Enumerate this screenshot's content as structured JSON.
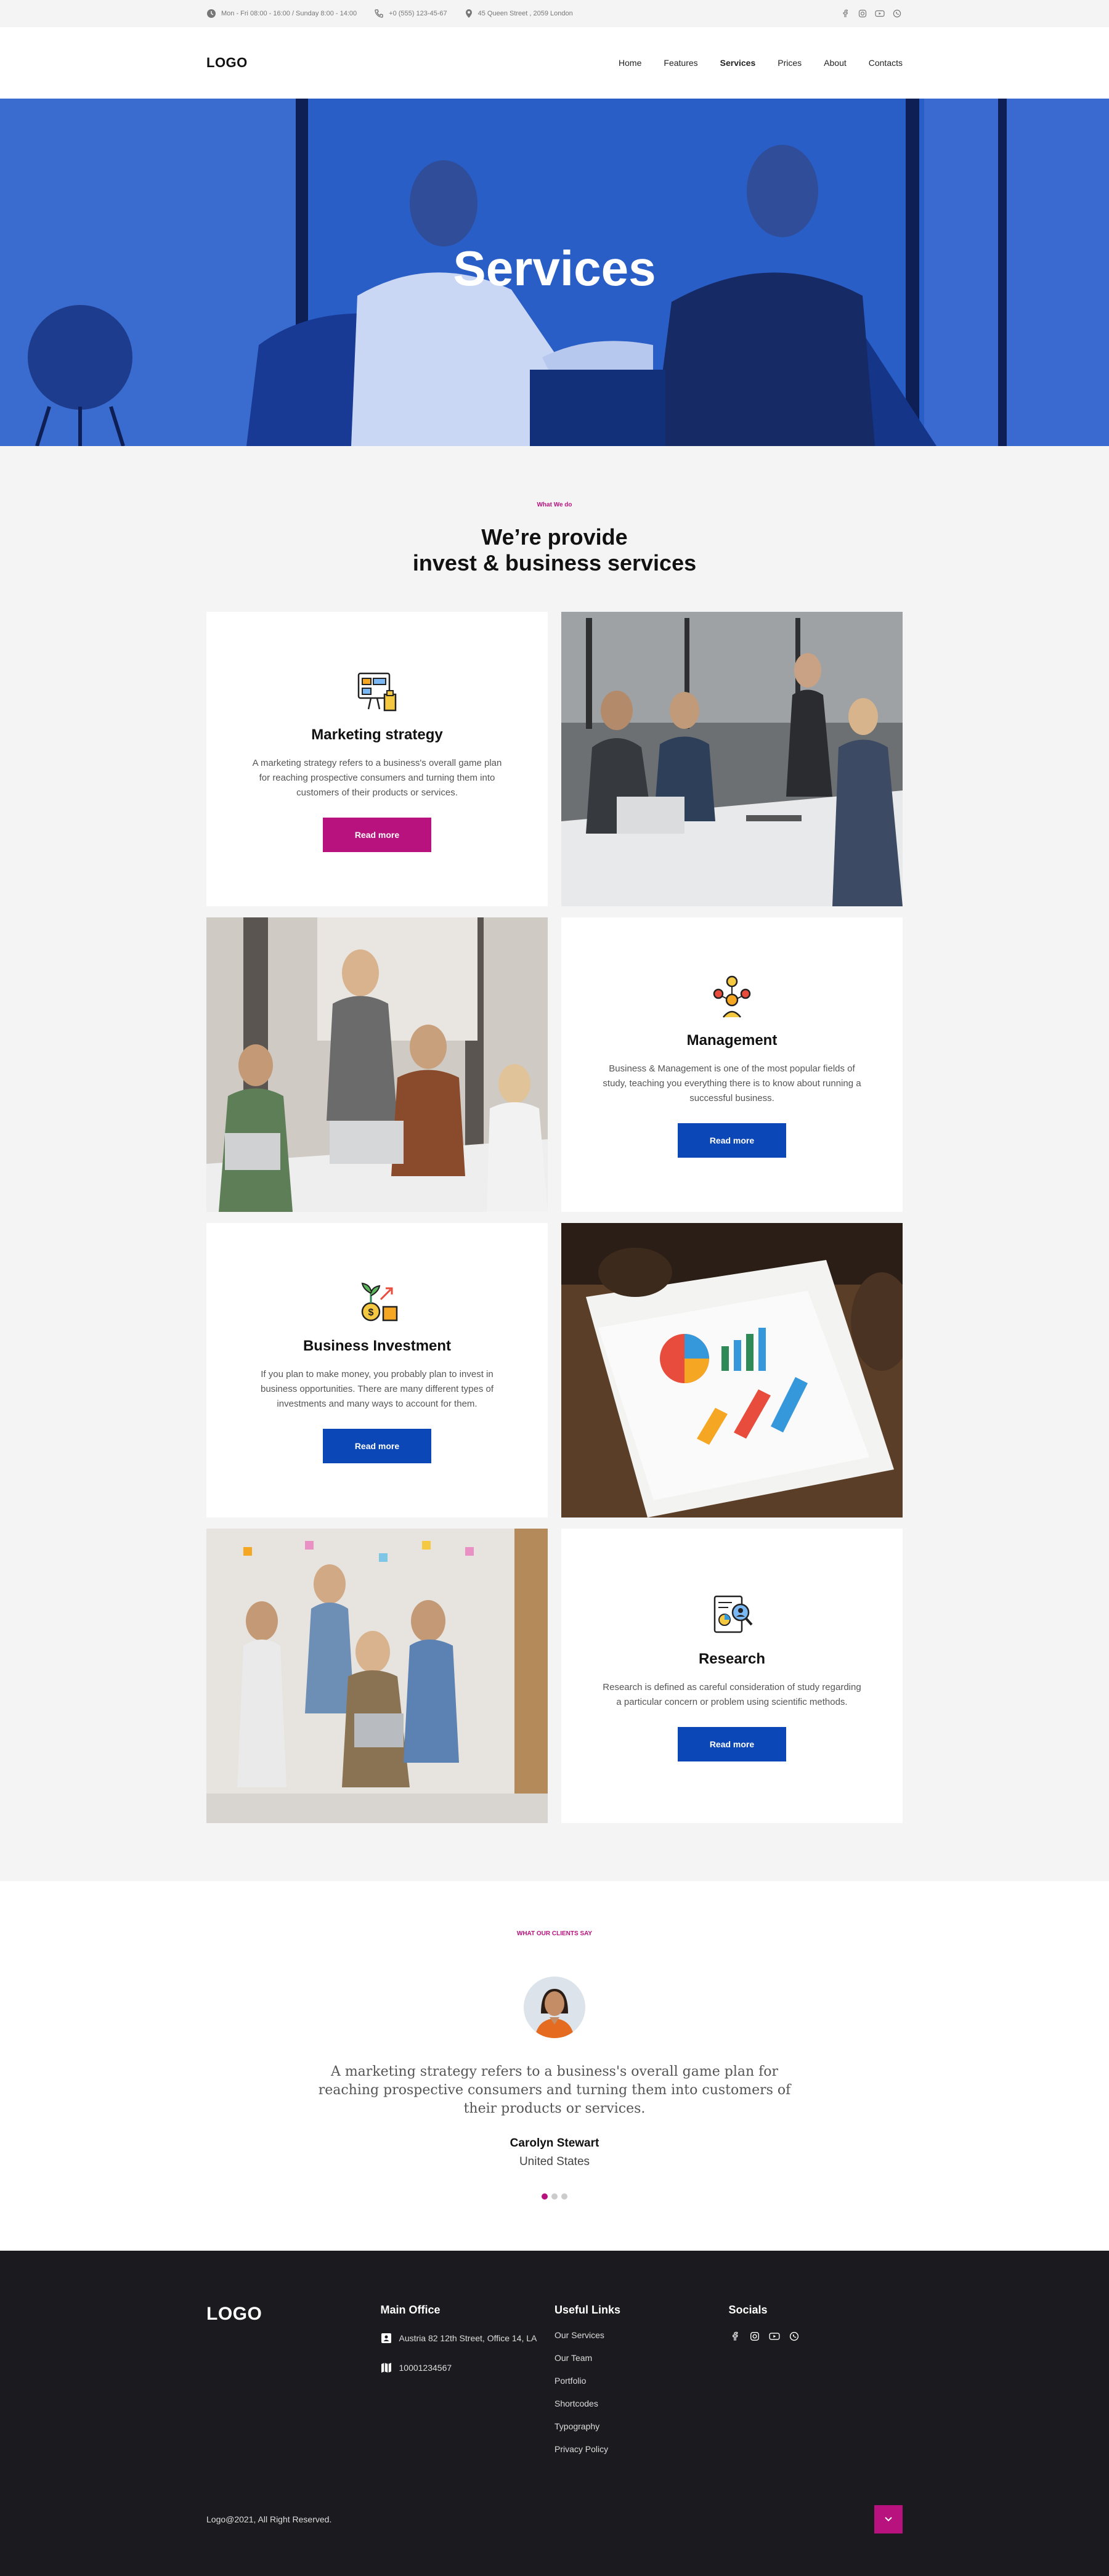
{
  "topbar": {
    "hours": "Mon - Fri 08:00 - 16:00 / Sunday 8:00 - 14:00",
    "phone": "+0 (555) 123-45-67",
    "address": "45 Queen Street , 2059 London",
    "social_icons": [
      "facebook-icon",
      "instagram-icon",
      "youtube-icon",
      "whatsapp-icon"
    ]
  },
  "header": {
    "logo": "LOGO",
    "nav": [
      "Home",
      "Features",
      "Services",
      "Prices",
      "About",
      "Contacts"
    ],
    "active": "Services"
  },
  "hero": {
    "title": "Services"
  },
  "services": {
    "eyebrow": "What We do",
    "title_line1": "We’re provide",
    "title_line2": "invest & business services",
    "cards": [
      {
        "title": "Marketing strategy",
        "text": "A marketing strategy refers to a business's overall game plan for reaching prospective consumers and turning them into customers of their products or services.",
        "button": "Read more",
        "button_color": "#b8127f"
      },
      {
        "title": "Management",
        "text": "Business & Management is one of the most popular fields of study, teaching you everything there is to know about running a successful business.",
        "button": "Read more",
        "button_color": "#0c47b7"
      },
      {
        "title": "Business Investment",
        "text": "If you plan to make money, you probably plan to invest in business opportunities. There are many different types of investments and many ways to account for them.",
        "button": "Read more",
        "button_color": "#0c47b7"
      },
      {
        "title": "Research",
        "text": "Research is defined as careful consideration of study regarding a particular concern or problem using scientific methods.",
        "button": "Read more",
        "button_color": "#0c47b7"
      }
    ]
  },
  "testimonials": {
    "eyebrow": "WHAT OUR CLIENTS SAY",
    "quote": "A marketing strategy refers to a business's overall game plan for reaching prospective consumers and turning them into customers of their products or services.",
    "author": "Carolyn Stewart",
    "country": "United States",
    "active_slide": 1,
    "slide_count": 3
  },
  "footer": {
    "logo": "LOGO",
    "main_office_heading": "Main Office",
    "address": "Austria 82 12th Street, Office 14, LA",
    "phone": "10001234567",
    "links_heading": "Useful Links",
    "links": [
      "Our Services",
      "Our Team",
      "Portfolio",
      "Shortcodes",
      "Typography",
      "Privacy Policy"
    ],
    "socials_heading": "Socials",
    "copyright": "Logo@2021, All Right Reserved."
  },
  "colors": {
    "accent_pink": "#b8127f",
    "accent_blue": "#0c47b7",
    "hero_blue": "#2a5ec7",
    "footer_bg": "#1b1b1f"
  }
}
